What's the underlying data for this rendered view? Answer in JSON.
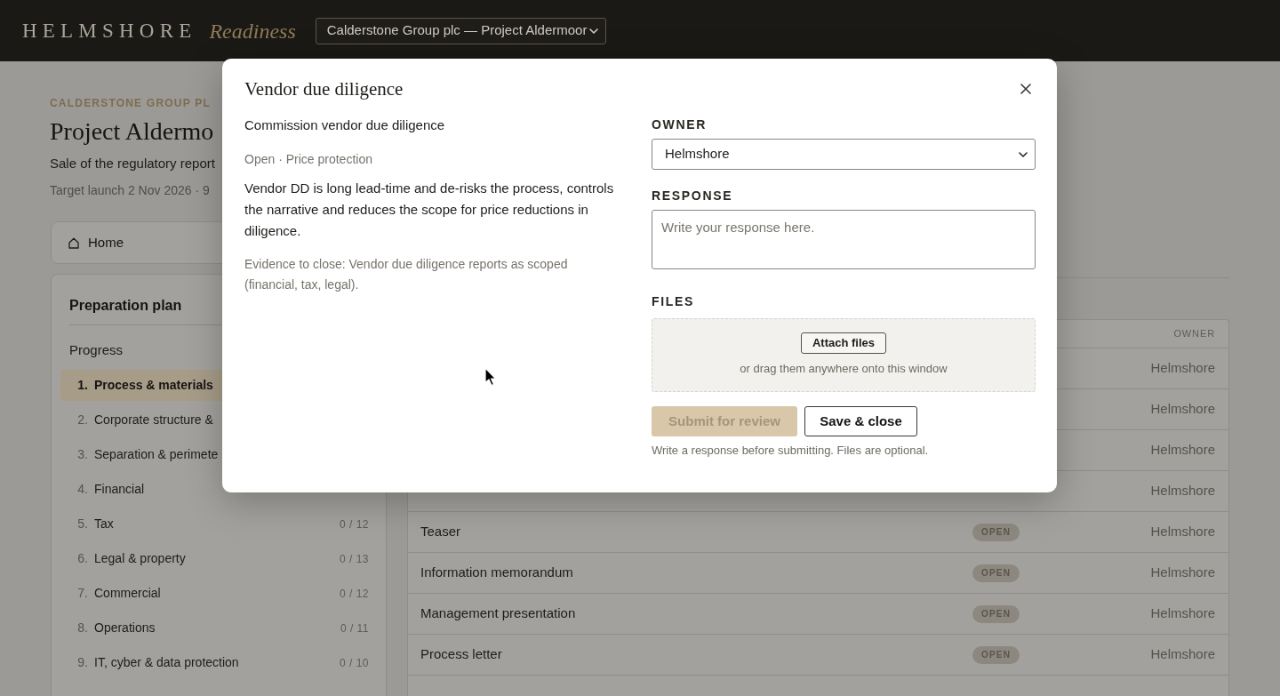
{
  "header": {
    "brand": "HELMSHORE",
    "product": "Readiness",
    "project_select": "Calderstone Group plc — Project Aldermoor"
  },
  "page": {
    "client": "CALDERSTONE GROUP PL",
    "title": "Project Aldermo",
    "subtitle": "Sale of the regulatory report",
    "meta": "Target launch 2 Nov 2026 · 9"
  },
  "nav": {
    "home": "Home"
  },
  "plan": {
    "title": "Preparation plan",
    "progress_label": "Progress",
    "sections": [
      {
        "number": "1.",
        "name": "Process & materials",
        "selected": true
      },
      {
        "number": "2.",
        "name": "Corporate structure &",
        "selected": false
      },
      {
        "number": "3.",
        "name": "Separation & perimete",
        "selected": false
      },
      {
        "number": "4.",
        "name": "Financial",
        "selected": false
      },
      {
        "number": "5.",
        "name": "Tax",
        "count": "0 / 12",
        "selected": false
      },
      {
        "number": "6.",
        "name": "Legal & property",
        "count": "0 / 13",
        "selected": false
      },
      {
        "number": "7.",
        "name": "Commercial",
        "count": "0 / 12",
        "selected": false
      },
      {
        "number": "8.",
        "name": "Operations",
        "count": "0 / 11",
        "selected": false
      },
      {
        "number": "9.",
        "name": "IT, cyber & data protection",
        "count": "0 / 10",
        "selected": false
      }
    ]
  },
  "table": {
    "owner_heading": "OWNER",
    "rows": [
      {
        "owner": "Helmshore"
      },
      {
        "owner": "Helmshore"
      },
      {
        "owner": "Helmshore"
      },
      {
        "owner": "Helmshore"
      },
      {
        "name": "Teaser",
        "status": "OPEN",
        "owner": "Helmshore"
      },
      {
        "name": "Information memorandum",
        "status": "OPEN",
        "owner": "Helmshore"
      },
      {
        "name": "Management presentation",
        "status": "OPEN",
        "owner": "Helmshore"
      },
      {
        "name": "Process letter",
        "status": "OPEN",
        "owner": "Helmshore"
      }
    ]
  },
  "dialog": {
    "title": "Vendor due diligence",
    "task": "Commission vendor due diligence",
    "meta": "Open · Price protection",
    "description": "Vendor DD is long lead-time and de-risks the process, controls the narrative and reduces the scope for price reductions in diligence.",
    "evidence": "Evidence to close: Vendor due diligence reports as scoped (financial, tax, legal).",
    "owner": {
      "label": "OWNER",
      "value": "Helmshore"
    },
    "response": {
      "label": "RESPONSE",
      "placeholder": "Write your response here."
    },
    "files": {
      "label": "FILES",
      "button": "Attach files",
      "hint": "or drag them anywhere onto this window"
    },
    "actions": [
      {
        "label": "Submit for review",
        "kind": "primary",
        "disabled": true
      },
      {
        "label": "Save & close",
        "kind": "secondary",
        "disabled": false
      }
    ],
    "hint": "Write a response before submitting. Files are optional."
  }
}
